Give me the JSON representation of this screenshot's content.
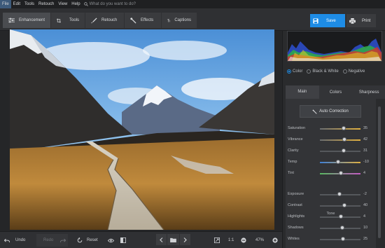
{
  "menu": {
    "items": [
      "File",
      "Edit",
      "Tools",
      "Retouch",
      "View",
      "Help"
    ],
    "search_placeholder": "What do you want to do?"
  },
  "toolbar": {
    "tabs": [
      {
        "label": "Enhancement",
        "icon": "sliders-icon"
      },
      {
        "label": "Tools",
        "icon": "crop-icon"
      },
      {
        "label": "Retouch",
        "icon": "brush-icon"
      },
      {
        "label": "Effects",
        "icon": "magic-wand-icon"
      },
      {
        "label": "Captions",
        "icon": "text-icon"
      }
    ],
    "save_label": "Save",
    "print_label": "Print",
    "accent": "#1e8ce6"
  },
  "bottom": {
    "undo": "Undo",
    "redo": "Redo",
    "reset": "Reset",
    "ratio": "1:1",
    "zoom": "47%"
  },
  "panel": {
    "modes": [
      "Color",
      "Black & White",
      "Negative"
    ],
    "selected_mode": "Color",
    "tabs": [
      "Main",
      "Colors",
      "Sharpness"
    ],
    "auto_correction": "Auto Correction",
    "tone_header": "Tone",
    "sliders": [
      {
        "label": "Saturation",
        "value": "35",
        "level": 0.59,
        "gradient": "linear-gradient(90deg,#6a6d71,#e0b040)"
      },
      {
        "label": "Vibrance",
        "value": "42",
        "level": 0.61,
        "gradient": "linear-gradient(90deg,#6a6d71,#e0b040)"
      },
      {
        "label": "Clarity",
        "value": "31",
        "level": 0.58,
        "gradient": ""
      },
      {
        "label": "Temp",
        "value": "-10",
        "level": 0.45,
        "gradient": "linear-gradient(90deg,#3e7fd6,#e0b040)"
      },
      {
        "label": "Tint",
        "value": "4",
        "level": 0.52,
        "gradient": "linear-gradient(90deg,#58b860,#c45ac4)"
      },
      {
        "label": "Exposure",
        "value": "-2",
        "level": 0.49,
        "gradient": ""
      },
      {
        "label": "Contrast",
        "value": "40",
        "level": 0.6,
        "gradient": ""
      },
      {
        "label": "Highlights",
        "value": "4",
        "level": 0.52,
        "gradient": ""
      },
      {
        "label": "Shadows",
        "value": "10",
        "level": 0.55,
        "gradient": ""
      },
      {
        "label": "Whites",
        "value": "25",
        "level": 0.57,
        "gradient": ""
      }
    ]
  }
}
